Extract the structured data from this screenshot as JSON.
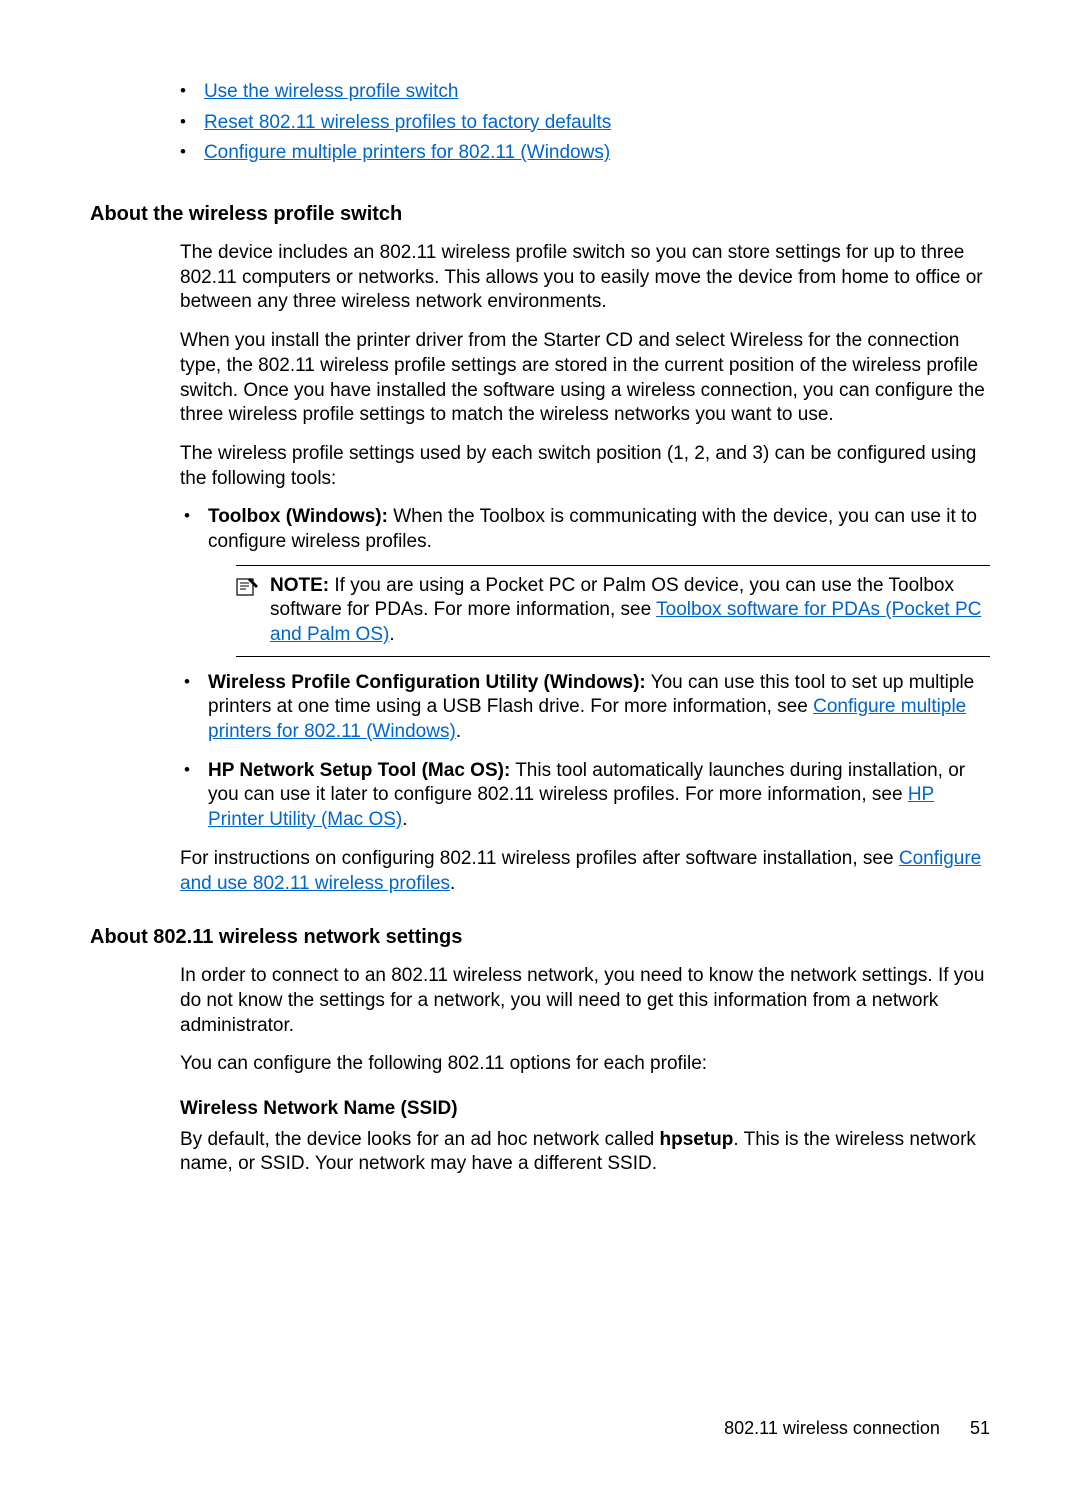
{
  "top_links": {
    "link1": "Use the wireless profile switch",
    "link2": "Reset 802.11 wireless profiles to factory defaults",
    "link3": "Configure multiple printers for 802.11 (Windows)"
  },
  "section1": {
    "heading": "About the wireless profile switch",
    "p1": "The device includes an 802.11 wireless profile switch so you can store settings for up to three 802.11 computers or networks. This allows you to easily move the device from home to office or between any three wireless network environments.",
    "p2": "When you install the printer driver from the Starter CD and select Wireless for the connection type, the 802.11 wireless profile settings are stored in the current position of the wireless profile switch. Once you have installed the software using a wireless connection, you can configure the three wireless profile settings to match the wireless networks you want to use.",
    "p3": "The wireless profile settings used by each switch position (1, 2, and 3) can be configured using the following tools:",
    "item1_bold": "Toolbox (Windows):",
    "item1_text": " When the Toolbox is communicating with the device, you can use it to configure wireless profiles.",
    "note_bold": "NOTE:",
    "note_text_a": "  If you are using a Pocket PC or Palm OS device, you can use the Toolbox software for PDAs. For more information, see ",
    "note_link": "Toolbox software for PDAs (Pocket PC and Palm OS)",
    "note_text_b": ".",
    "item2_bold": "Wireless Profile Configuration Utility (Windows):",
    "item2_text_a": " You can use this tool to set up multiple printers at one time using a USB Flash drive. For more information, see ",
    "item2_link": "Configure multiple printers for 802.11 (Windows)",
    "item2_text_b": ".",
    "item3_bold": "HP Network Setup Tool (Mac OS):",
    "item3_text_a": " This tool automatically launches during installation, or you can use it later to configure 802.11 wireless profiles. For more information, see ",
    "item3_link": "HP Printer Utility (Mac OS)",
    "item3_text_b": ".",
    "p4_a": "For instructions on configuring 802.11 wireless profiles after software installation, see ",
    "p4_link": "Configure and use 802.11 wireless profiles",
    "p4_b": "."
  },
  "section2": {
    "heading": "About 802.11 wireless network settings",
    "p1": "In order to connect to an 802.11 wireless network, you need to know the network settings. If you do not know the settings for a network, you will need to get this information from a network administrator.",
    "p2": "You can configure the following 802.11 options for each profile:",
    "sub_heading": "Wireless Network Name (SSID)",
    "p3_a": "By default, the device looks for an ad hoc network called ",
    "p3_bold": "hpsetup",
    "p3_b": ". This is the wireless network name, or SSID. Your network may have a different SSID."
  },
  "footer": {
    "label": "802.11 wireless connection",
    "page": "51"
  }
}
